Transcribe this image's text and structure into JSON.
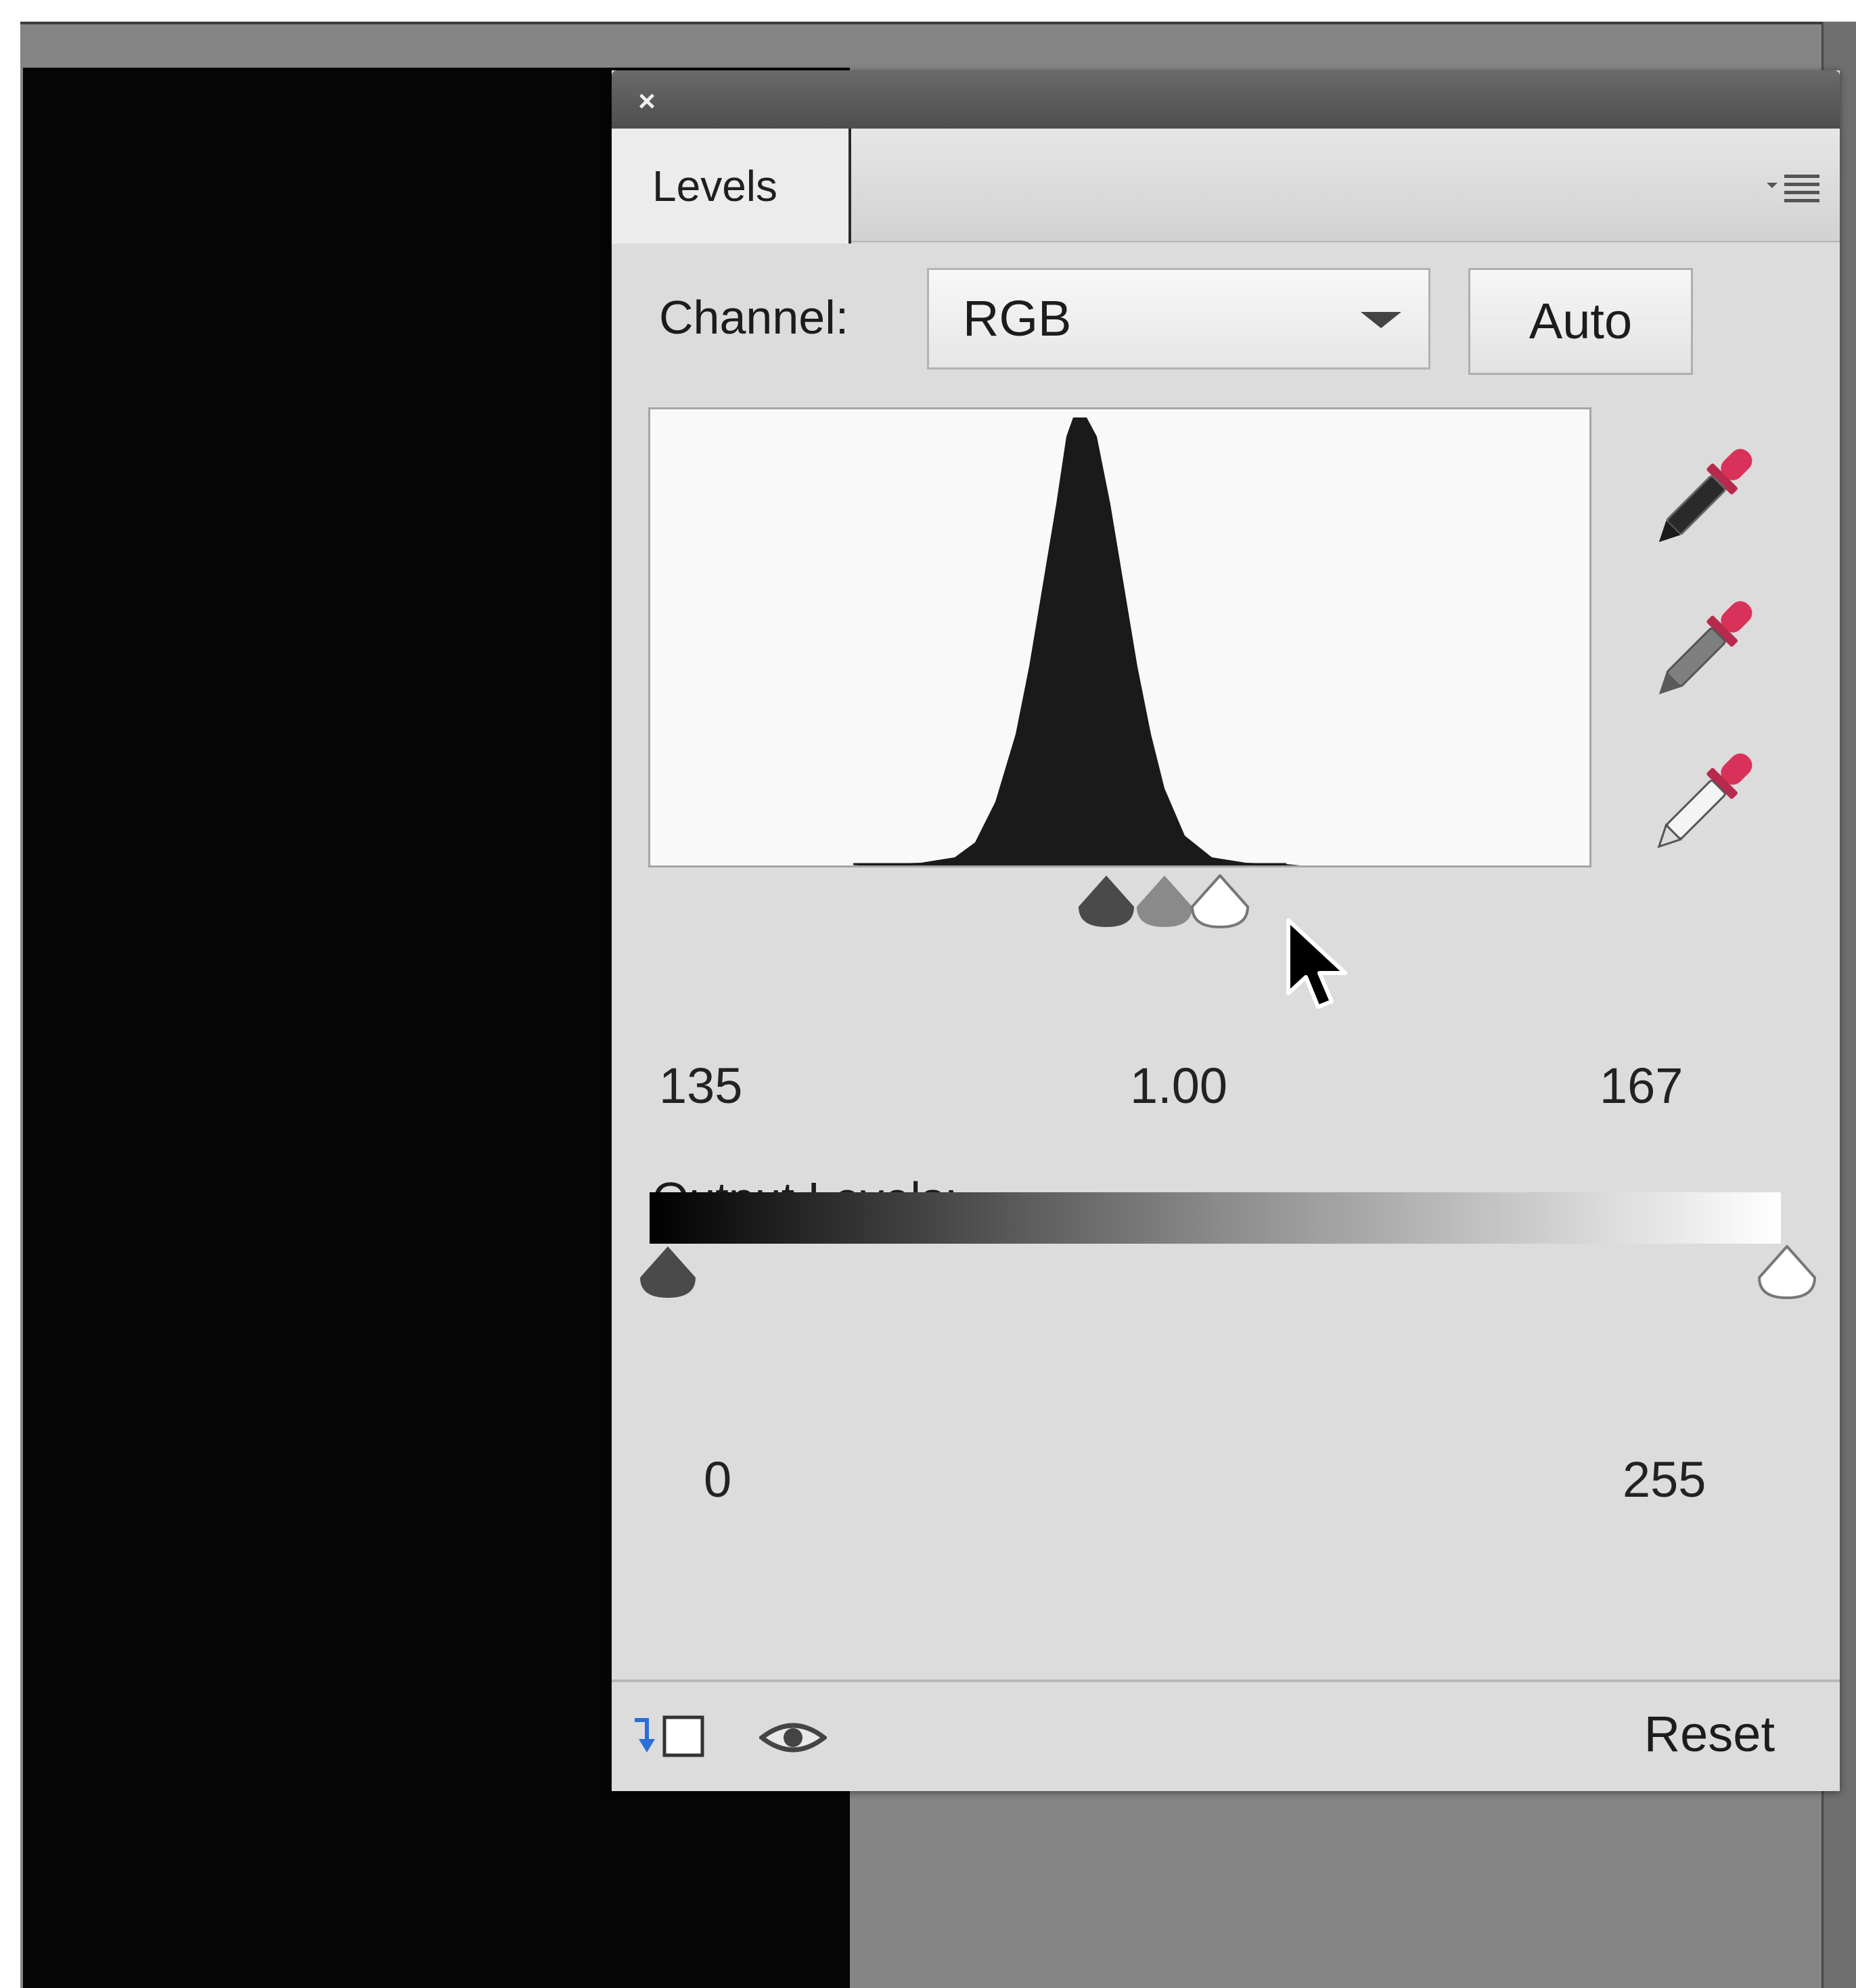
{
  "panel": {
    "close_glyph": "×",
    "tab_title": "Levels",
    "menu_icon": "panel-menu-icon"
  },
  "channel": {
    "label": "Channel:",
    "value": "RGB",
    "auto_label": "Auto"
  },
  "input_levels": {
    "black": "135",
    "gamma": "1.00",
    "white": "167"
  },
  "output_levels": {
    "label": "Output Levels:",
    "black": "0",
    "white": "255"
  },
  "footer": {
    "reset_label": "Reset"
  },
  "colors": {
    "panel_bg": "#dcdcdc",
    "titlebar": "#5a5a5a",
    "eyedropper_red": "#d9325a",
    "clip_icon_blue": "#2a6fd6"
  }
}
